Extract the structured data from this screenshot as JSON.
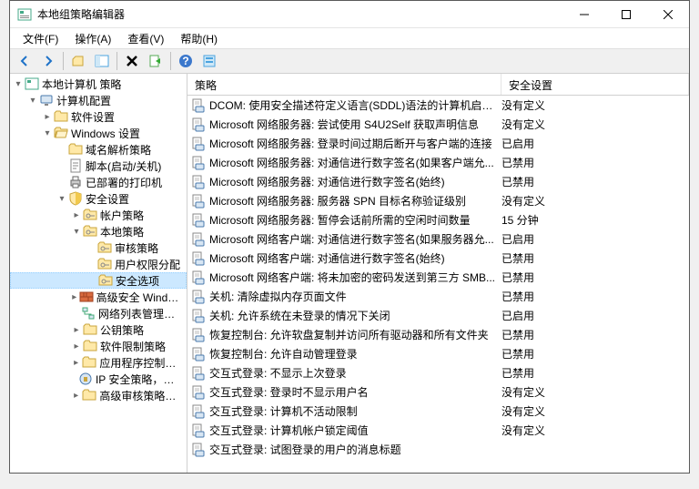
{
  "window": {
    "title": "本地组策略编辑器"
  },
  "menu": {
    "file": "文件(F)",
    "action": "操作(A)",
    "view": "查看(V)",
    "help": "帮助(H)"
  },
  "toolbar": {
    "back": "back",
    "forward": "forward",
    "up": "up",
    "show_hide": "show-hide",
    "delete": "delete",
    "export": "export",
    "help": "help",
    "refresh": "refresh"
  },
  "tree": {
    "root": "本地计算机 策略",
    "computer_config": "计算机配置",
    "software": "软件设置",
    "windows": "Windows 设置",
    "dns": "域名解析策略",
    "scripts": "脚本(启动/关机)",
    "printers": "已部署的打印机",
    "security": "安全设置",
    "account": "帐户策略",
    "local": "本地策略",
    "audit": "审核策略",
    "user_rights": "用户权限分配",
    "security_options": "安全选项",
    "adv_sec_win": "高级安全 Windows 防火墙",
    "net_list": "网络列表管理器策略",
    "public_key": "公钥策略",
    "software_restrict": "软件限制策略",
    "app_control": "应用程序控制策略",
    "ip_sec": "IP 安全策略，在 本地计算机",
    "adv_audit": "高级审核策略配置"
  },
  "list": {
    "headers": {
      "policy": "策略",
      "setting": "安全设置"
    },
    "rows": [
      {
        "name": "DCOM: 使用安全描述符定义语言(SDDL)语法的计算机启动...",
        "value": "没有定义"
      },
      {
        "name": "Microsoft 网络服务器: 尝试使用 S4U2Self 获取声明信息",
        "value": "没有定义"
      },
      {
        "name": "Microsoft 网络服务器: 登录时间过期后断开与客户端的连接",
        "value": "已启用"
      },
      {
        "name": "Microsoft 网络服务器: 对通信进行数字签名(如果客户端允...",
        "value": "已禁用"
      },
      {
        "name": "Microsoft 网络服务器: 对通信进行数字签名(始终)",
        "value": "已禁用"
      },
      {
        "name": "Microsoft 网络服务器: 服务器 SPN 目标名称验证级别",
        "value": "没有定义"
      },
      {
        "name": "Microsoft 网络服务器: 暂停会话前所需的空闲时间数量",
        "value": "15 分钟"
      },
      {
        "name": "Microsoft 网络客户端: 对通信进行数字签名(如果服务器允...",
        "value": "已启用"
      },
      {
        "name": "Microsoft 网络客户端: 对通信进行数字签名(始终)",
        "value": "已禁用"
      },
      {
        "name": "Microsoft 网络客户端: 将未加密的密码发送到第三方 SMB...",
        "value": "已禁用"
      },
      {
        "name": "关机: 清除虚拟内存页面文件",
        "value": "已禁用"
      },
      {
        "name": "关机: 允许系统在未登录的情况下关闭",
        "value": "已启用"
      },
      {
        "name": "恢复控制台: 允许软盘复制并访问所有驱动器和所有文件夹",
        "value": "已禁用"
      },
      {
        "name": "恢复控制台: 允许自动管理登录",
        "value": "已禁用"
      },
      {
        "name": "交互式登录: 不显示上次登录",
        "value": "已禁用"
      },
      {
        "name": "交互式登录: 登录时不显示用户名",
        "value": "没有定义"
      },
      {
        "name": "交互式登录: 计算机不活动限制",
        "value": "没有定义"
      },
      {
        "name": "交互式登录: 计算机帐户锁定阈值",
        "value": "没有定义"
      },
      {
        "name": "交互式登录: 试图登录的用户的消息标题",
        "value": ""
      }
    ]
  }
}
